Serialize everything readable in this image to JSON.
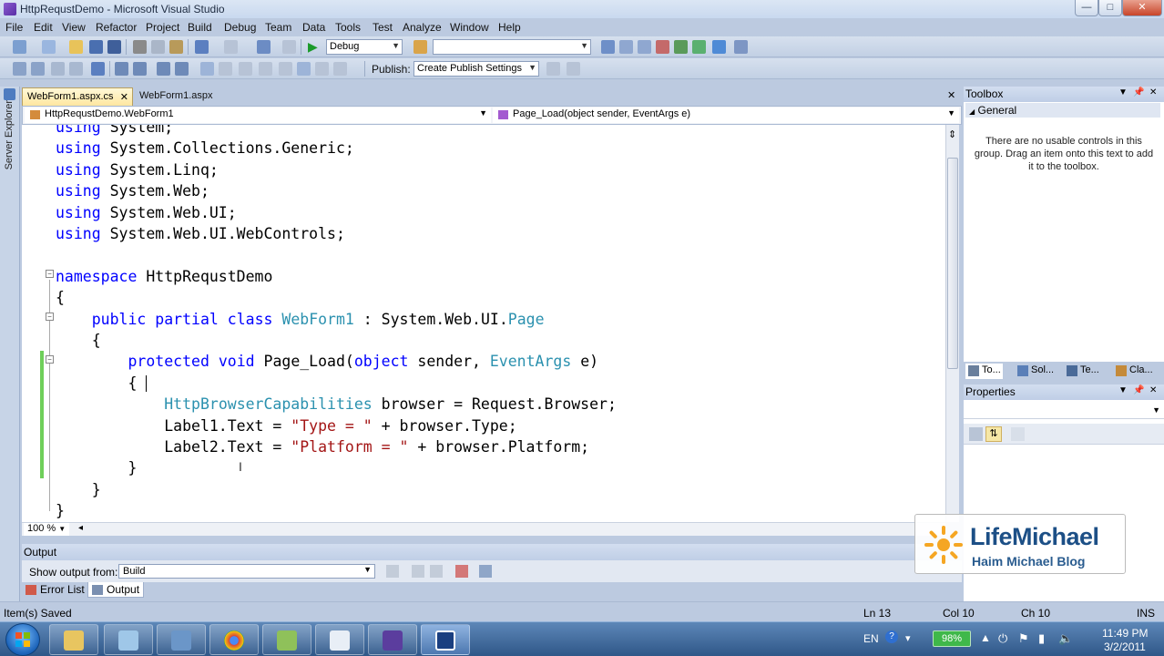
{
  "window": {
    "title": "HttpRequstDemo - Microsoft Visual Studio",
    "min_glyph": "—",
    "max_glyph": "□",
    "close_glyph": "✕"
  },
  "menu": [
    "File",
    "Edit",
    "View",
    "Refactor",
    "Project",
    "Build",
    "Debug",
    "Team",
    "Data",
    "Tools",
    "Test",
    "Analyze",
    "Window",
    "Help"
  ],
  "toolbar": {
    "config_value": "Debug",
    "platform_value": "",
    "publish_label": "Publish:",
    "publish_value": "Create Publish Settings"
  },
  "left_sidebar": {
    "server_explorer": "Server Explorer"
  },
  "tabs": [
    {
      "label": "WebForm1.aspx.cs",
      "active": true
    },
    {
      "label": "WebForm1.aspx",
      "active": false
    }
  ],
  "navbar": {
    "class_value": "HttpRequstDemo.WebForm1",
    "member_value": "Page_Load(object sender, EventArgs e)"
  },
  "code": {
    "lines": [
      [
        {
          "t": "using",
          "c": "kw"
        },
        {
          "t": " System;",
          "c": ""
        }
      ],
      [
        {
          "t": "using",
          "c": "kw"
        },
        {
          "t": " System.Collections.Generic;",
          "c": ""
        }
      ],
      [
        {
          "t": "using",
          "c": "kw"
        },
        {
          "t": " System.Linq;",
          "c": ""
        }
      ],
      [
        {
          "t": "using",
          "c": "kw"
        },
        {
          "t": " System.Web;",
          "c": ""
        }
      ],
      [
        {
          "t": "using",
          "c": "kw"
        },
        {
          "t": " System.Web.UI;",
          "c": ""
        }
      ],
      [
        {
          "t": "using",
          "c": "kw"
        },
        {
          "t": " System.Web.UI.WebControls;",
          "c": ""
        }
      ],
      [],
      [
        {
          "t": "namespace",
          "c": "kw"
        },
        {
          "t": " HttpRequstDemo",
          "c": ""
        }
      ],
      [
        {
          "t": "{",
          "c": ""
        }
      ],
      [
        {
          "t": "    ",
          "c": ""
        },
        {
          "t": "public",
          "c": "kw"
        },
        {
          "t": " ",
          "c": ""
        },
        {
          "t": "partial",
          "c": "kw"
        },
        {
          "t": " ",
          "c": ""
        },
        {
          "t": "class",
          "c": "kw"
        },
        {
          "t": " ",
          "c": ""
        },
        {
          "t": "WebForm1",
          "c": "ty"
        },
        {
          "t": " : System.Web.UI.",
          "c": ""
        },
        {
          "t": "Page",
          "c": "ty"
        }
      ],
      [
        {
          "t": "    {",
          "c": ""
        }
      ],
      [
        {
          "t": "        ",
          "c": ""
        },
        {
          "t": "protected",
          "c": "kw"
        },
        {
          "t": " ",
          "c": ""
        },
        {
          "t": "void",
          "c": "kw"
        },
        {
          "t": " Page_Load(",
          "c": ""
        },
        {
          "t": "object",
          "c": "kw"
        },
        {
          "t": " sender, ",
          "c": ""
        },
        {
          "t": "EventArgs",
          "c": "ty"
        },
        {
          "t": " e)",
          "c": ""
        }
      ],
      [
        {
          "t": "        {",
          "c": ""
        }
      ],
      [
        {
          "t": "            ",
          "c": ""
        },
        {
          "t": "HttpBrowserCapabilities",
          "c": "ty"
        },
        {
          "t": " browser = Request.Browser;",
          "c": ""
        }
      ],
      [
        {
          "t": "            Label1.Text = ",
          "c": ""
        },
        {
          "t": "\"Type = \"",
          "c": "st"
        },
        {
          "t": " + browser.Type;",
          "c": ""
        }
      ],
      [
        {
          "t": "            Label2.Text = ",
          "c": ""
        },
        {
          "t": "\"Platform = \"",
          "c": "st"
        },
        {
          "t": " + browser.Platform;",
          "c": ""
        }
      ],
      [
        {
          "t": "        }",
          "c": ""
        }
      ],
      [
        {
          "t": "    }",
          "c": ""
        }
      ],
      [
        {
          "t": "}",
          "c": ""
        }
      ]
    ]
  },
  "editor": {
    "zoom": "100 %"
  },
  "toolbox": {
    "title": "Toolbox",
    "group": "General",
    "empty_text": "There are no usable controls in this group. Drag an item onto this text to add it to the toolbox.",
    "bottom_tabs": [
      "To...",
      "Sol...",
      "Te...",
      "Cla..."
    ]
  },
  "properties": {
    "title": "Properties"
  },
  "output": {
    "title": "Output",
    "show_from_label": "Show output from:",
    "source_value": "Build"
  },
  "panel_tabs": [
    {
      "label": "Error List",
      "active": false
    },
    {
      "label": "Output",
      "active": true
    }
  ],
  "status": {
    "message": "Item(s) Saved",
    "ln": "Ln 13",
    "col": "Col 10",
    "ch": "Ch 10",
    "mode": "INS"
  },
  "watermark": {
    "title": "LifeMichael",
    "subtitle": "Haim Michael Blog"
  },
  "taskbar": {
    "language": "EN",
    "battery": "98%",
    "time": "11:49 PM",
    "date": "3/2/2011"
  }
}
